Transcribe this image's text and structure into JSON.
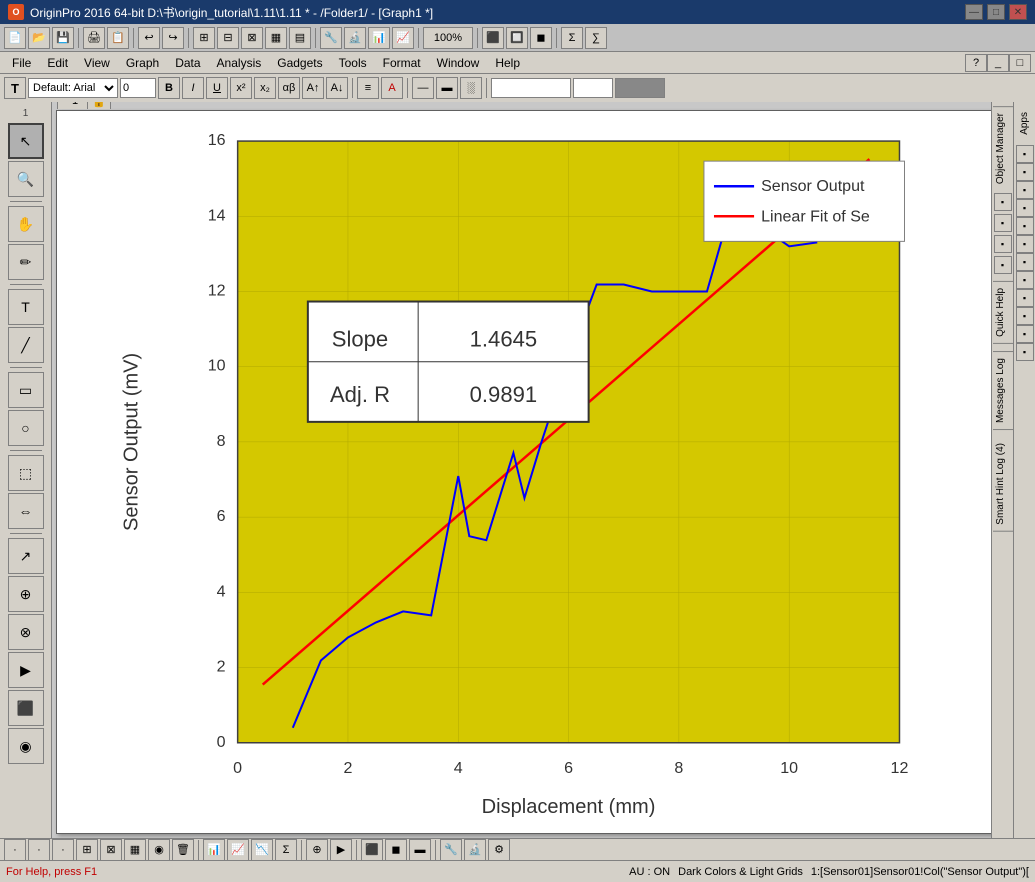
{
  "title_bar": {
    "app_name": "OriginPro 2016 64-bit",
    "path": "D:\\书\\origin_tutorial\\1.11\\1.11 * - /Folder1/ - [Graph1 *]",
    "full_title": "OriginPro 2016 64-bit  D:\\书\\origin_tutorial\\1.11\\1.11 * - /Folder1/ - [Graph1 *]",
    "icon_label": "O"
  },
  "menu": {
    "items": [
      "File",
      "Edit",
      "View",
      "Graph",
      "Data",
      "Analysis",
      "Gadgets",
      "Tools",
      "Format",
      "Window",
      "Help"
    ]
  },
  "toolbar": {
    "zoom_level": "100%",
    "font_name": "Default: Arial",
    "font_size": "0",
    "font_size2": "0"
  },
  "graph": {
    "tab_label": "1",
    "title": "Graph1",
    "x_label": "Displacement (mm)",
    "y_label": "Sensor Output (mV)",
    "x_min": 0,
    "x_max": 12,
    "y_min": 0,
    "y_max": 16,
    "x_ticks": [
      "0",
      "2",
      "4",
      "6",
      "8",
      "10",
      "12"
    ],
    "y_ticks": [
      "0",
      "2",
      "4",
      "6",
      "8",
      "10",
      "12",
      "14",
      "16"
    ],
    "bg_color": "#d4c800",
    "grid_color": "#b8b000",
    "legend": {
      "sensor_output_label": "Sensor Output",
      "linear_fit_label": "Linear Fit of Se",
      "sensor_color": "#0000ff",
      "fit_color": "#ff0000"
    },
    "stats_box": {
      "slope_label": "Slope",
      "slope_value": "1.4645",
      "adj_r_label": "Adj. R",
      "adj_r_value": "0.9891"
    },
    "sensor_data": [
      [
        1.0,
        0.4
      ],
      [
        1.5,
        2.2
      ],
      [
        2.0,
        2.8
      ],
      [
        2.5,
        3.2
      ],
      [
        3.0,
        3.5
      ],
      [
        3.5,
        3.4
      ],
      [
        4.0,
        7.1
      ],
      [
        4.2,
        5.5
      ],
      [
        4.5,
        5.4
      ],
      [
        5.0,
        7.7
      ],
      [
        5.2,
        6.5
      ],
      [
        5.5,
        8.0
      ],
      [
        6.0,
        10.2
      ],
      [
        6.5,
        12.2
      ],
      [
        7.0,
        12.2
      ],
      [
        7.5,
        12.0
      ],
      [
        8.0,
        12.0
      ],
      [
        8.5,
        12.0
      ],
      [
        9.0,
        14.5
      ],
      [
        9.5,
        13.7
      ],
      [
        10.0,
        13.2
      ],
      [
        10.5,
        13.3
      ]
    ],
    "fit_data": [
      [
        0.8,
        1.5
      ],
      [
        10.5,
        15.5
      ]
    ]
  },
  "right_labels": {
    "apps": "Apps",
    "object_manager": "Object Manager",
    "quick_help": "Quick Help",
    "messages_log": "Messages Log",
    "smart_hint_log": "Smart Hint Log (4)"
  },
  "status_bar": {
    "help_text": "For Help, press F1",
    "au_status": "AU : ON",
    "dark_colors": "Dark Colors & Light Grids",
    "data_info": "1:[Sensor01]Sensor01!Col(\"Sensor Output\")["
  }
}
